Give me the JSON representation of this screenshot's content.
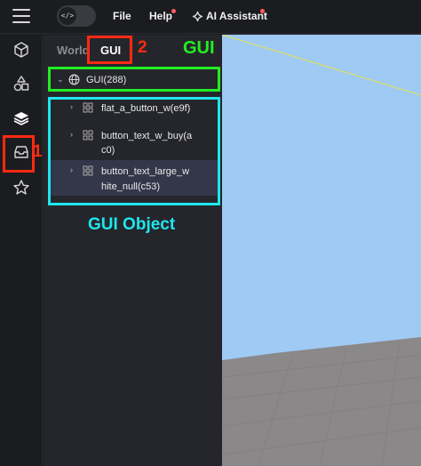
{
  "topbar": {
    "menu_file": "File",
    "menu_help": "Help",
    "menu_ai": "AI Assistant",
    "code_toggle_glyph": "</>"
  },
  "rail": {
    "icons": [
      "cube-icon",
      "shapes-icon",
      "layers-icon",
      "inbox-icon",
      "star-icon"
    ],
    "active_index": 2
  },
  "panel": {
    "tab_world": "World",
    "tab_gui": "GUI",
    "root_item": "GUI(288)",
    "children": [
      {
        "line1": "flat_a_button_w(e9f)",
        "line2": ""
      },
      {
        "line1": "button_text_w_buy(a",
        "line2": "c0)"
      },
      {
        "line1": "button_text_large_w",
        "line2": "hite_null(c53)"
      }
    ]
  },
  "annotations": {
    "step1": "1",
    "step2": "2",
    "gui_label": "GUI",
    "gui_object_label": "GUI Object"
  },
  "colors": {
    "highlight_red": "#ff2a12",
    "highlight_green": "#22ee22",
    "highlight_cyan": "#1ee6ee",
    "sky": "#9fcaf4",
    "ground": "#8a8888"
  }
}
